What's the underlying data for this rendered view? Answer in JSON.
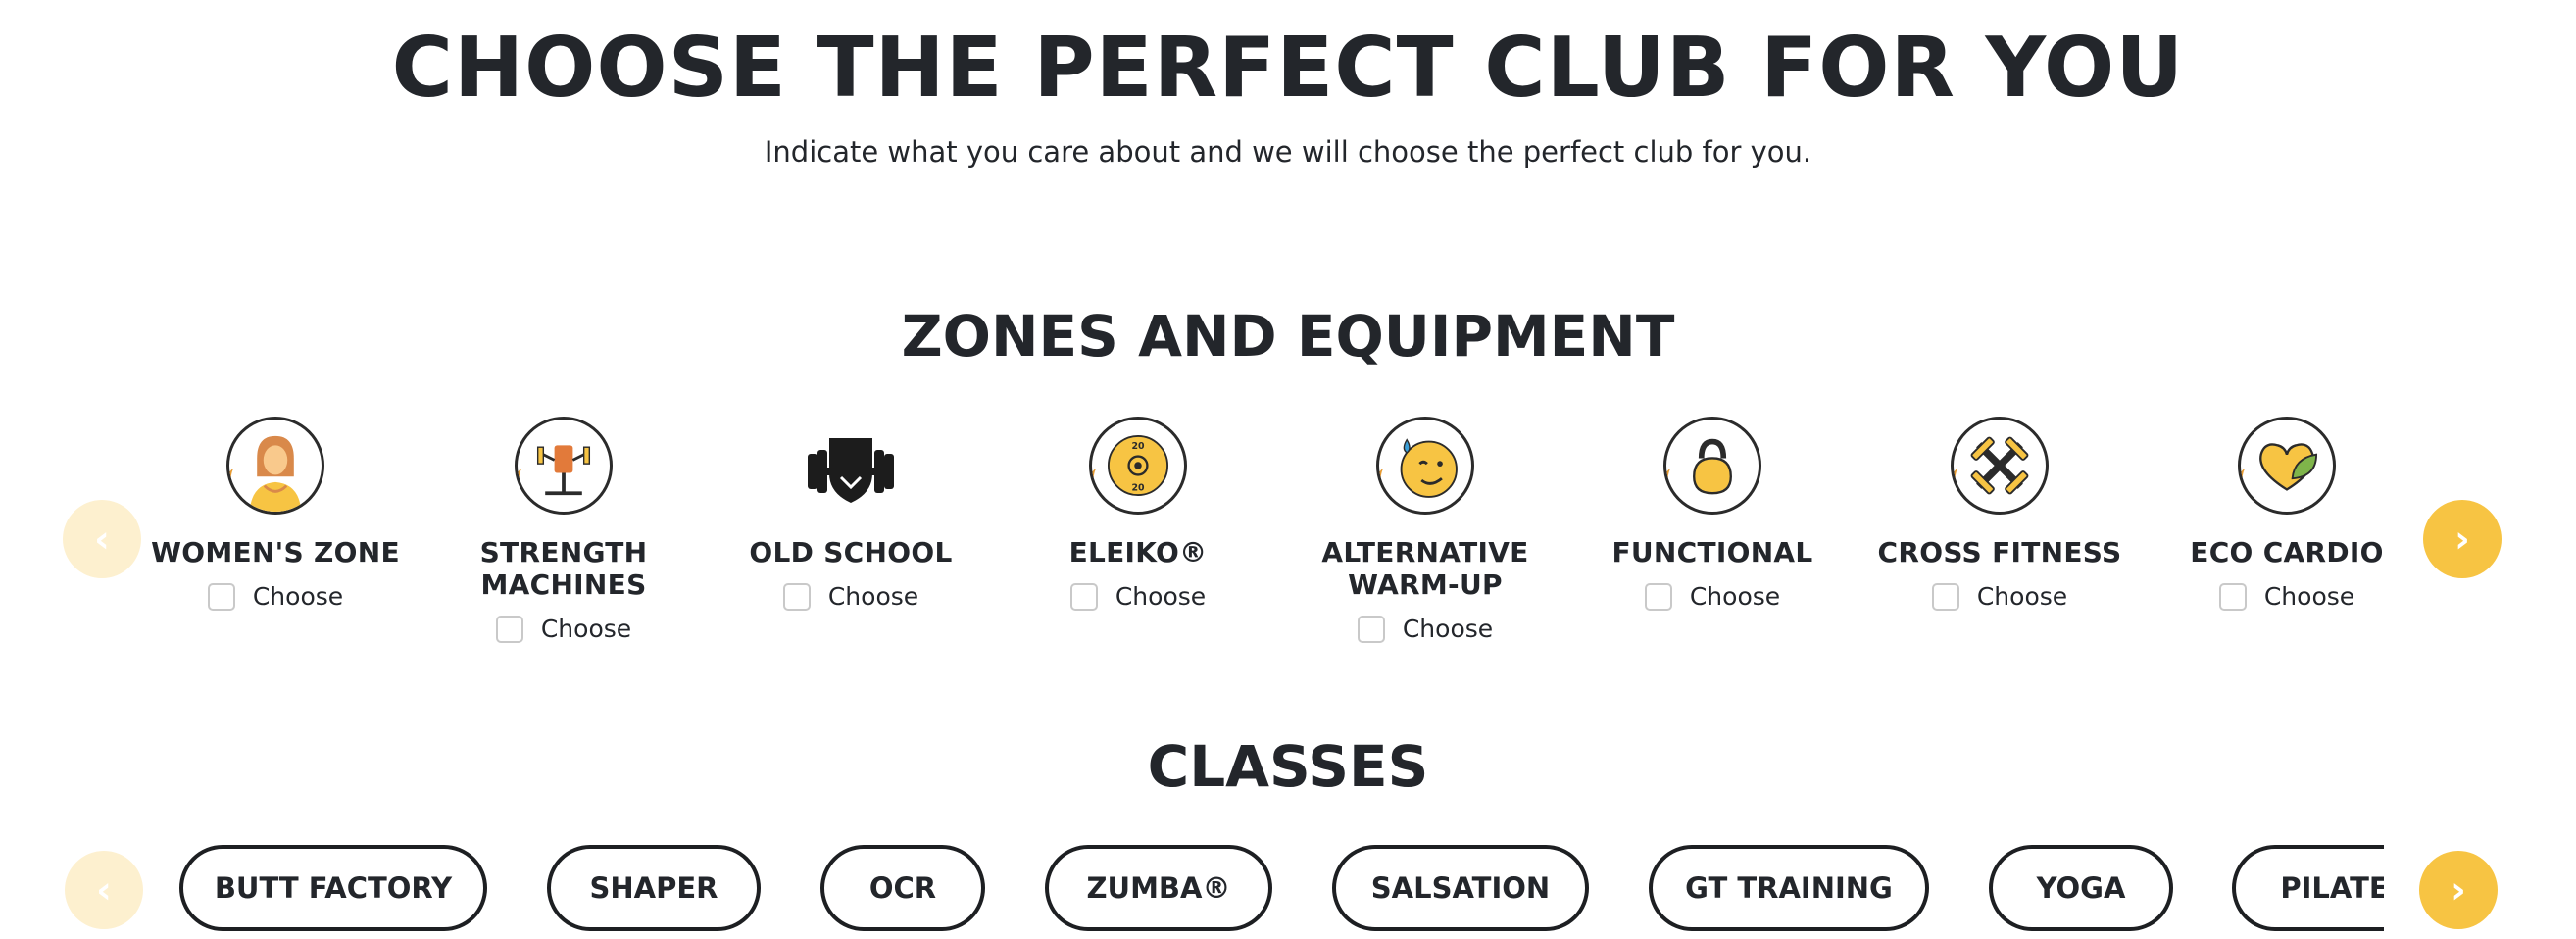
{
  "header": {
    "title": "CHOOSE THE PERFECT CLUB FOR YOU",
    "subtitle": "Indicate what you care about and we will choose the perfect club for you."
  },
  "zones": {
    "title": "ZONES AND EQUIPMENT",
    "prev_arrow": "‹",
    "next_arrow": "›",
    "items": [
      {
        "label": "WOMEN'S ZONE",
        "choose": "Choose",
        "icon": "woman-icon"
      },
      {
        "label": "STRENGTH MACHINES",
        "choose": "Choose",
        "icon": "strength-machine-icon"
      },
      {
        "label": "OLD SCHOOL",
        "choose": "Choose",
        "icon": "dumbbell-shield-icon"
      },
      {
        "label": "ELEIKO®",
        "choose": "Choose",
        "icon": "weight-plate-icon",
        "plate_text": "20"
      },
      {
        "label": "ALTERNATIVE WARM-UP",
        "choose": "Choose",
        "icon": "sweating-face-icon"
      },
      {
        "label": "FUNCTIONAL",
        "choose": "Choose",
        "icon": "kettlebell-icon"
      },
      {
        "label": "CROSS FITNESS",
        "choose": "Choose",
        "icon": "crossed-dumbbells-icon"
      },
      {
        "label": "ECO CARDIO",
        "choose": "Choose",
        "icon": "heart-leaf-icon"
      }
    ]
  },
  "classes": {
    "title": "CLASSES",
    "prev_arrow": "‹",
    "next_arrow": "›",
    "items": [
      "BUTT FACTORY",
      "SHAPER",
      "OCR",
      "ZUMBA®",
      "SALSATION",
      "GT TRAINING",
      "YOGA",
      "PILATES"
    ]
  },
  "colors": {
    "accent_yellow": "#f7c443",
    "accent_yellow_light": "#fdf0cf",
    "accent_orange": "#e59a33",
    "text_dark": "#23262b"
  }
}
